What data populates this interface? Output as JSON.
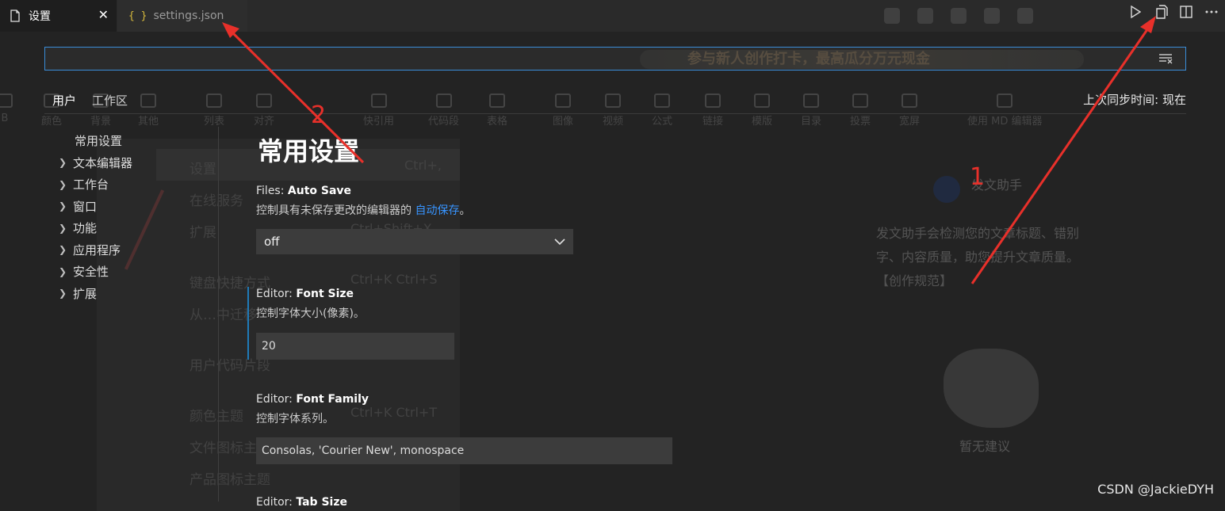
{
  "tabs": [
    {
      "label": "设置",
      "icon": "file-icon",
      "close": "✕"
    },
    {
      "label": "settings.json",
      "icon": "json-braces-icon",
      "glyph": "{ }"
    }
  ],
  "toolbar": {
    "icons": [
      "run-icon",
      "open-settings-json-icon",
      "split-editor-icon",
      "more-actions-icon"
    ]
  },
  "search": {
    "placeholder": "",
    "value": "",
    "filter_icon": "filter-icon"
  },
  "scopes": {
    "user": "用户",
    "workspace": "工作区",
    "more": "•••"
  },
  "sync": {
    "text": "上次同步时间: 现在"
  },
  "toc": {
    "common": "常用设置",
    "items": [
      "文本编辑器",
      "工作台",
      "窗口",
      "功能",
      "应用程序",
      "安全性",
      "扩展"
    ]
  },
  "section": {
    "title": "常用设置"
  },
  "settings": {
    "auto_save": {
      "category": "Files: ",
      "name": "Auto Save",
      "desc_prefix": "控制具有未保存更改的编辑器的 ",
      "desc_link": "自动保存",
      "desc_suffix": "。",
      "value": "off"
    },
    "font_size": {
      "category": "Editor: ",
      "name": "Font Size",
      "desc": "控制字体大小(像素)。",
      "value": "20"
    },
    "font_family": {
      "category": "Editor: ",
      "name": "Font Family",
      "desc": "控制字体系列。",
      "value": "Consolas, 'Courier New', monospace"
    },
    "tab_size": {
      "category": "Editor: ",
      "name": "Tab Size"
    }
  },
  "ghost": {
    "banner": "参与新人创作打卡，最高瓜分万元现金",
    "toolbar": [
      "B",
      "颜色",
      "背景",
      "其他",
      "列表",
      "对齐",
      "",
      "快引用",
      "代码段",
      "表格",
      "图像",
      "视频",
      "公式",
      "链接",
      "模版",
      "目录",
      "投票",
      "宽屏",
      "使用 MD 编辑器"
    ],
    "menu": [
      {
        "label": "设置",
        "key": "Ctrl+,"
      },
      {
        "label": "在线服务",
        "key": ""
      },
      {
        "label": "扩展",
        "key": "Ctrl+Shift+X"
      },
      {
        "label": "键盘快捷方式",
        "key": "Ctrl+K Ctrl+S"
      },
      {
        "label": "从…中迁移",
        "key": ""
      },
      {
        "label": "用户代码片段",
        "key": ""
      },
      {
        "label": "颜色主题",
        "key": "Ctrl+K Ctrl+T"
      },
      {
        "label": "文件图标主题",
        "key": ""
      },
      {
        "label": "产品图标主题",
        "key": ""
      }
    ],
    "assistant_title": "发文助手",
    "assistant_text": "发文助手会检测您的文章标题、错别字、内容质量，助您提升文章质量。【创作规范】",
    "assistant_empty": "暂无建议"
  },
  "annotations": {
    "one": "1",
    "two": "2"
  },
  "watermark": "CSDN @JackieDYH"
}
